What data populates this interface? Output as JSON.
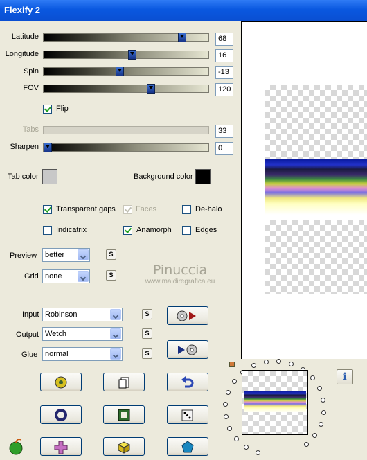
{
  "window": {
    "title": "Flexify 2"
  },
  "sliders": [
    {
      "label": "Latitude",
      "value": "68",
      "fraction": 0.86,
      "disabled": false
    },
    {
      "label": "Longitude",
      "value": "16",
      "fraction": 0.54,
      "disabled": false
    },
    {
      "label": "Spin",
      "value": "-13",
      "fraction": 0.46,
      "disabled": false
    },
    {
      "label": "FOV",
      "value": "120",
      "fraction": 0.66,
      "disabled": false
    },
    {
      "label": "Tabs",
      "value": "33",
      "fraction": null,
      "disabled": true
    },
    {
      "label": "Sharpen",
      "value": "0",
      "fraction": 0.0,
      "disabled": false
    }
  ],
  "flip": {
    "label": "Flip",
    "checked": true
  },
  "colors": {
    "tab_label": "Tab color",
    "tab_value": "#c8c8c8",
    "bg_label": "Background color",
    "bg_value": "#000000"
  },
  "options": {
    "transparent_gaps": {
      "label": "Transparent gaps",
      "checked": true
    },
    "faces": {
      "label": "Faces",
      "checked": true,
      "disabled": true
    },
    "dehalo": {
      "label": "De-halo",
      "checked": false
    },
    "indicatrix": {
      "label": "Indicatrix",
      "checked": false
    },
    "anamorph": {
      "label": "Anamorph",
      "checked": true
    },
    "edges": {
      "label": "Edges",
      "checked": false
    }
  },
  "preview": {
    "label": "Preview",
    "value": "better"
  },
  "grid": {
    "label": "Grid",
    "value": "none"
  },
  "input": {
    "label": "Input",
    "value": "Robinson"
  },
  "output": {
    "label": "Output",
    "value": "Wetch"
  },
  "glue": {
    "label": "Glue",
    "value": "normal"
  },
  "s_button": "S",
  "watermark": {
    "line1": "Pinuccia",
    "line2": "www.maidiregrafica.eu"
  },
  "info_button": "i",
  "icons": {
    "btn1": "to-output-icon",
    "btn2": "to-input-icon",
    "row1": [
      "gear-disc-icon",
      "pages-icon",
      "undo-icon"
    ],
    "row2": [
      "ring-icon",
      "square-frame-icon",
      "dice-icon"
    ],
    "row3": [
      "plus-icon",
      "cube-icon",
      "pentagon-icon"
    ],
    "bottom_left": "apple-logo-icon"
  }
}
